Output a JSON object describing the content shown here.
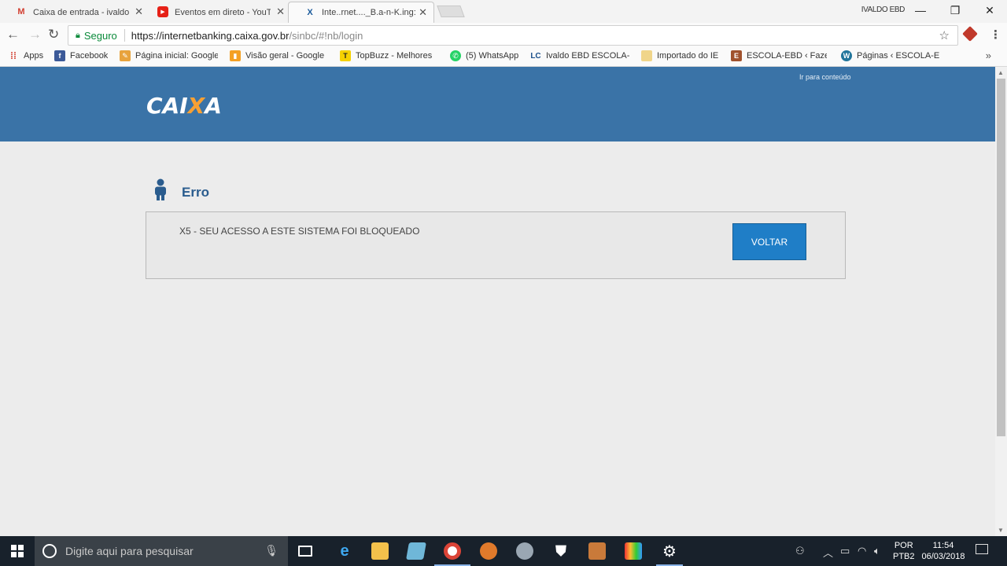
{
  "browser": {
    "tabs": [
      {
        "title": "Caixa de entrada - ivaldo",
        "icon": "gmail-icon",
        "close": "✕"
      },
      {
        "title": "Eventos em direto - YouTube",
        "icon": "youtube-icon",
        "close": "✕"
      },
      {
        "title": "Inte..rnet...._B.a-n-K.ing:",
        "icon": "caixa-icon",
        "close": "✕",
        "active": true
      }
    ],
    "profile_name": "IVALDO EBD",
    "window_controls": {
      "minimize": "—",
      "restore": "❐",
      "close": "✕"
    }
  },
  "toolbar": {
    "secure_label": "Seguro",
    "url_host": "https://internetbanking.caixa.gov.br",
    "url_path": "/sinbc/#!nb/login"
  },
  "bookmarks": [
    {
      "label": "Apps",
      "icon": "apps-grid-icon",
      "color": "#d23f31"
    },
    {
      "label": "Facebook",
      "icon": "facebook-icon",
      "color": "#3b5998"
    },
    {
      "label": "Página inicial: Google",
      "icon": "google-sites-icon",
      "color": "#e8a33d"
    },
    {
      "label": "Visão geral - Google",
      "icon": "google-analytics-icon",
      "color": "#f4a024"
    },
    {
      "label": "TopBuzz - Melhores",
      "icon": "topbuzz-icon",
      "color": "#f6d100"
    },
    {
      "label": "(5) WhatsApp",
      "icon": "whatsapp-icon",
      "color": "#25d366"
    },
    {
      "label": "Ivaldo EBD ESCOLA-E",
      "icon": "lc-icon",
      "color": "#1a4f8b"
    },
    {
      "label": "Importado do IE",
      "icon": "folder-icon",
      "color": "#f0d58a"
    },
    {
      "label": "ESCOLA-EBD ‹ Fazer",
      "icon": "escola-icon",
      "color": "#a0522d"
    },
    {
      "label": "Páginas ‹ ESCOLA-EB",
      "icon": "wordpress-icon",
      "color": "#21759b"
    }
  ],
  "page": {
    "skip_link": "Ir para conteúdo",
    "logo": {
      "left": "CAI",
      "x": "X",
      "right": "A"
    },
    "error_title": "Erro",
    "error_message": "X5 - SEU ACESSO A ESTE SISTEMA FOI BLOQUEADO",
    "back_button": "VOLTAR"
  },
  "taskbar": {
    "search_placeholder": "Digite aqui para pesquisar",
    "language_top": "POR",
    "language_bottom": "PTB2",
    "time": "11:54",
    "date": "06/03/2018"
  },
  "colors": {
    "header_blue": "#3a73a7",
    "button_blue": "#1f7ec7",
    "logo_orange": "#f7a033",
    "title_blue": "#2a5c8e"
  }
}
